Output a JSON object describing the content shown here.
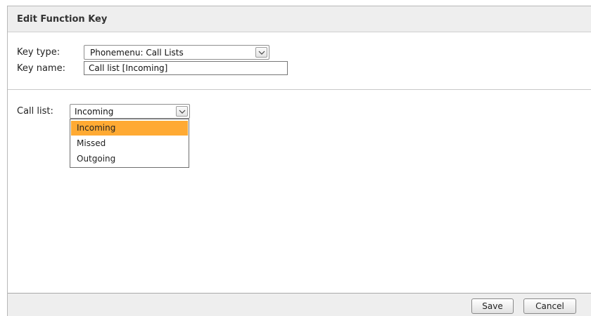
{
  "dialog": {
    "title": "Edit Function Key"
  },
  "form": {
    "key_type_label": "Key type:",
    "key_type_value": "Phonemenu: Call Lists",
    "key_name_label": "Key name:",
    "key_name_value": "Call list [Incoming]",
    "call_list_label": "Call list:",
    "call_list_value": "Incoming"
  },
  "dropdown": {
    "options": [
      "Incoming",
      "Missed",
      "Outgoing"
    ],
    "selected": "Incoming"
  },
  "footer": {
    "save_label": "Save",
    "cancel_label": "Cancel"
  },
  "colors": {
    "highlight": "#ffaa33",
    "titlebar_bg": "#eeeeee",
    "footer_bg": "#eeeeee"
  }
}
